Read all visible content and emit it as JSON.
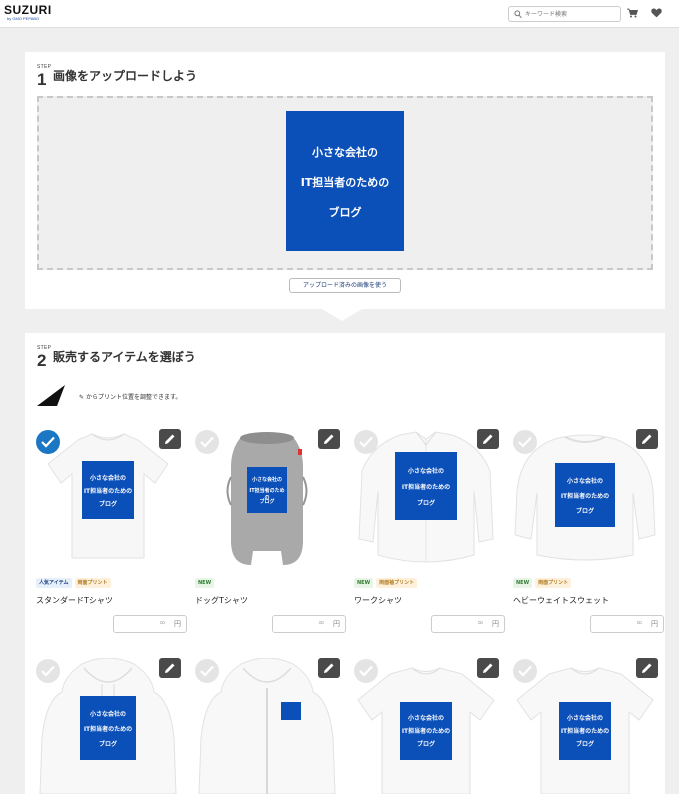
{
  "header": {
    "logo": "SUZURI",
    "logo_sub": "by GMO PEPABO",
    "search_placeholder": "キーワード検索",
    "icons": [
      "search-icon",
      "cart-icon",
      "heart-icon"
    ]
  },
  "step1": {
    "label": "STEP",
    "number": "1",
    "title": "画像をアップロードしよう",
    "design_lines": [
      "小さな会社の",
      "IT担当者のための",
      "ブログ"
    ],
    "reuse_button": "アップロード済みの画像を使う"
  },
  "step2": {
    "label": "STEP",
    "number": "2",
    "title": "販売するアイテムを選ぼう",
    "hint": "からプリント位置を調整できます。"
  },
  "price_placeholder": "∞",
  "currency": "円",
  "colors": {
    "accent": "#1b77c3",
    "design_blue": "#0b4fb8",
    "edit_button": "#4a4a4a"
  },
  "products": [
    {
      "name": "スタンダードTシャツ",
      "badges": [
        {
          "text": "人気アイテム",
          "kind": "pop"
        },
        {
          "text": "両面プリント",
          "kind": "print"
        }
      ],
      "selected": true
    },
    {
      "name": "ドッグTシャツ",
      "badges": [
        {
          "text": "NEW",
          "kind": "new"
        }
      ],
      "selected": false
    },
    {
      "name": "ワークシャツ",
      "badges": [
        {
          "text": "NEW",
          "kind": "new"
        },
        {
          "text": "両面袖プリント",
          "kind": "print"
        }
      ],
      "selected": false
    },
    {
      "name": "ヘビーウェイトスウェット",
      "badges": [
        {
          "text": "NEW",
          "kind": "new"
        },
        {
          "text": "両面プリント",
          "kind": "print"
        }
      ],
      "selected": false
    },
    {
      "name": "",
      "badges": [],
      "selected": false
    },
    {
      "name": "",
      "badges": [],
      "selected": false
    },
    {
      "name": "",
      "badges": [],
      "selected": false
    },
    {
      "name": "",
      "badges": [],
      "selected": false
    }
  ]
}
